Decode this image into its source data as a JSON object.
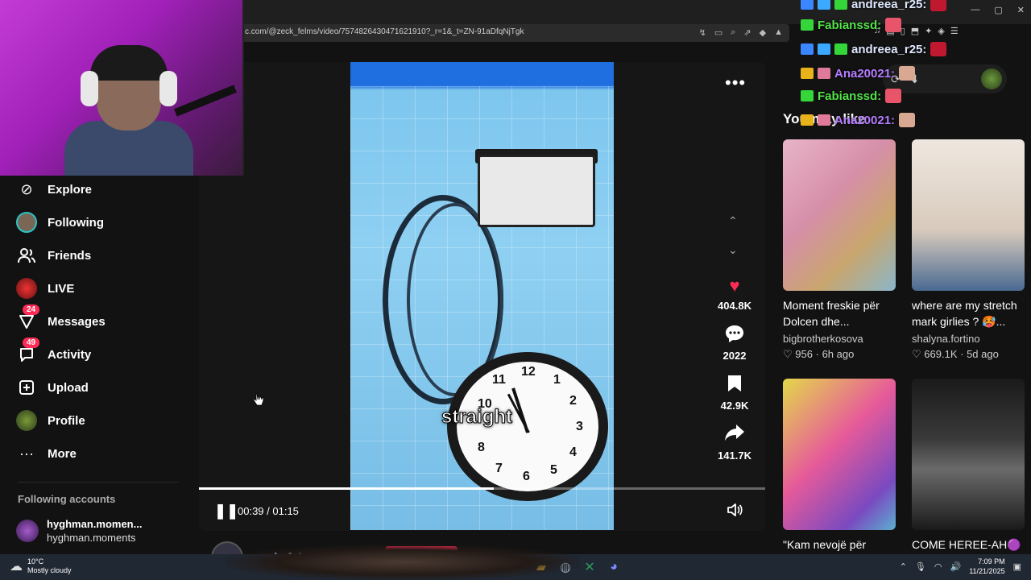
{
  "browser": {
    "url": "c.com/@zeck_felms/video/7574826430471621910?_r=1&_t=ZN-91aDfqNjTgk",
    "address_icons": [
      "↯",
      "▭",
      "⌕",
      "⇗",
      "◆",
      "▲"
    ],
    "extension_icons": [
      "♫",
      "▤",
      "▯",
      "⬒",
      "✦",
      "◈",
      "☰"
    ],
    "window_controls": [
      "—",
      "▢",
      "✕"
    ]
  },
  "sidebar": {
    "items": [
      {
        "label": "Explore",
        "icon": "compass-icon",
        "glyph": "⊘"
      },
      {
        "label": "Following",
        "icon": "following-avatar-icon",
        "glyph": ""
      },
      {
        "label": "Friends",
        "icon": "friends-icon",
        "glyph": "👥"
      },
      {
        "label": "LIVE",
        "icon": "live-icon",
        "glyph": ""
      },
      {
        "label": "Messages",
        "icon": "messages-icon",
        "glyph": "▽",
        "badge": "24"
      },
      {
        "label": "Activity",
        "icon": "activity-icon",
        "glyph": "▢",
        "badge": "49"
      },
      {
        "label": "Upload",
        "icon": "upload-icon",
        "glyph": "⊞"
      },
      {
        "label": "Profile",
        "icon": "profile-icon",
        "glyph": ""
      },
      {
        "label": "More",
        "icon": "more-icon",
        "glyph": "···"
      }
    ],
    "following_title": "Following accounts",
    "following_accounts": [
      {
        "name": "hyghman.momen...",
        "handle": "hyghman.moments"
      }
    ]
  },
  "video": {
    "caption": "straight",
    "clock_numbers": [
      "11",
      "12",
      "1",
      "2",
      "3",
      "4",
      "5",
      "6",
      "7",
      "8",
      "10"
    ],
    "elapsed": "00:39",
    "duration": "01:15",
    "time_display": "00:39 / 01:15",
    "progress": 0.52,
    "more_glyph": "•••",
    "nav_up_glyph": "⌃",
    "nav_down_glyph": "⌄",
    "pause_glyph": "❚❚",
    "volume_glyph": "🔈",
    "author": "zeck_felms",
    "actions": [
      {
        "name": "like",
        "glyph": "♥",
        "count": "404.8K",
        "color": "#fe2c55"
      },
      {
        "name": "comment",
        "glyph": "💬",
        "count": "2022",
        "color": "#ffffff"
      },
      {
        "name": "save",
        "glyph": "🔖",
        "count": "42.9K",
        "color": "#ffffff"
      },
      {
        "name": "share",
        "glyph": "➦",
        "count": "141.7K",
        "color": "#ffffff"
      }
    ]
  },
  "recommendations": {
    "title": "You may like",
    "cards": [
      {
        "title": "Moment freskie për Dolcen dhe...",
        "author": "bigbrotherkosova",
        "likes": "956",
        "age": "6h ago"
      },
      {
        "title": "where are my stretch mark girlies ? 🥵...",
        "author": "shalyna.fortino",
        "likes": "669.1K",
        "age": "5d ago"
      },
      {
        "title": "\"Kam nevojë për",
        "author": "",
        "likes": "",
        "age": ""
      },
      {
        "title": "COME HEREE-AH🟣",
        "author": "",
        "likes": "",
        "age": ""
      }
    ],
    "like_glyph": "♡"
  },
  "chat": {
    "messages": [
      {
        "user": "andreea_r25:",
        "color": "#dfe8ff"
      },
      {
        "user": "Fabianssd:",
        "color": "#54e24a"
      },
      {
        "user": "andreea_r25:",
        "color": "#dfe8ff"
      },
      {
        "user": "Ana20021:",
        "color": "#b57cff"
      },
      {
        "user": "Fabianssd:",
        "color": "#54e24a"
      },
      {
        "user": "Ana20021:",
        "color": "#b57cff"
      }
    ]
  },
  "extension_popup": {
    "icons": [
      "⟳",
      "⬇"
    ]
  },
  "taskbar": {
    "weather_temp": "10°C",
    "weather_desc": "Mostly cloudy",
    "time": "7:09 PM",
    "date": "11/21/2025",
    "apps": [
      "⊞",
      "▣",
      "◉",
      "◐",
      "◓",
      "▰",
      "◍",
      "✕",
      "◕"
    ]
  },
  "colors": {
    "accent": "#fe2c55",
    "background": "#121212",
    "taskbar": "#202833"
  }
}
